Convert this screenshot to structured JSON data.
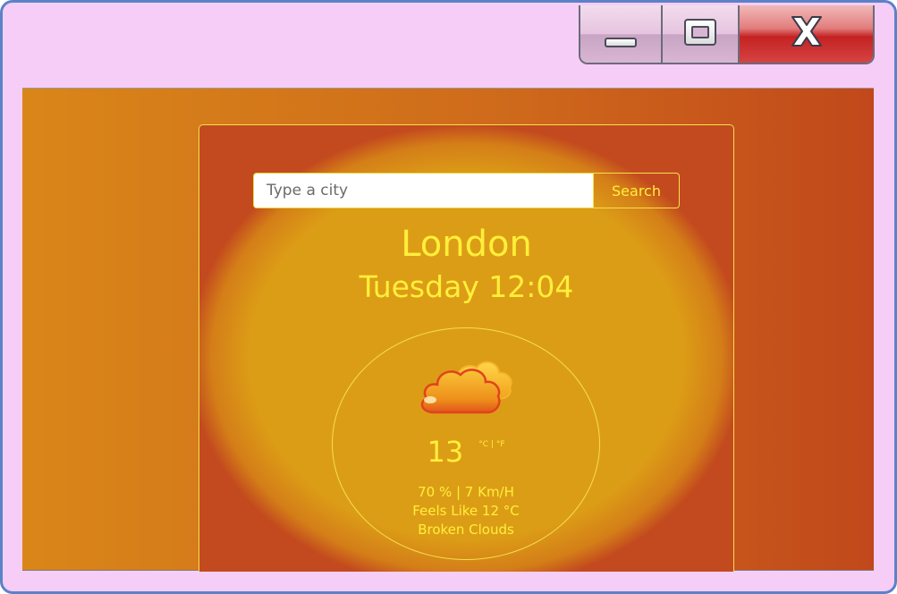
{
  "window": {
    "controls": {
      "minimize_icon": "minimize-icon",
      "maximize_icon": "maximize-icon",
      "close_icon": "close-icon"
    },
    "frame_color": "#5b82c9",
    "background_color": "#f6cdf6"
  },
  "search": {
    "placeholder": "Type a city",
    "value": "",
    "button_label": "Search"
  },
  "weather": {
    "city": "London",
    "datetime": "Tuesday 12:04",
    "icon": "broken-clouds-icon",
    "temperature": "13",
    "unit_celsius": "°C",
    "unit_separator": "|",
    "unit_fahrenheit": "°F",
    "humidity_wind": "70 % | 7 Km/H",
    "feels_like": "Feels Like 12 °C",
    "description": "Broken Clouds"
  },
  "colors": {
    "accent_text": "#ffef3a",
    "card_fill": "#dc9d16",
    "background_left": "#d98619",
    "background_right": "#c1481b"
  }
}
